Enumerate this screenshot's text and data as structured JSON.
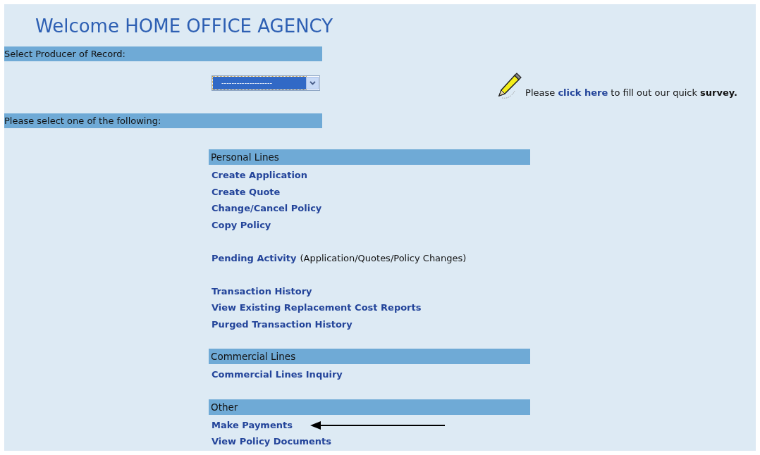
{
  "title": "Welcome HOME OFFICE AGENCY",
  "producer": {
    "label": "Select Producer of Record:",
    "select_value": "--------------------"
  },
  "survey": {
    "before": "Please",
    "link": "click here",
    "after": "to fill out our quick",
    "bold": "survey."
  },
  "prompt": "Please select one of the following:",
  "sections": [
    {
      "title": "Personal Lines",
      "groups": [
        [
          {
            "link": "Create Application"
          },
          {
            "link": "Create Quote"
          },
          {
            "link": "Change/Cancel Policy"
          },
          {
            "link": "Copy Policy"
          }
        ],
        [
          {
            "link": "Pending Activity",
            "note": "(Application/Quotes/Policy Changes)"
          }
        ],
        [
          {
            "link": "Transaction History"
          },
          {
            "link": "View Existing Replacement Cost Reports"
          },
          {
            "link": "Purged Transaction History"
          }
        ]
      ]
    },
    {
      "title": "Commercial Lines",
      "groups": [
        [
          {
            "link": "Commercial Lines Inquiry"
          }
        ]
      ]
    },
    {
      "title": "Other",
      "groups": [
        [
          {
            "link": "Make Payments",
            "pointed_at": true
          },
          {
            "link": "View Policy Documents"
          }
        ]
      ]
    }
  ]
}
